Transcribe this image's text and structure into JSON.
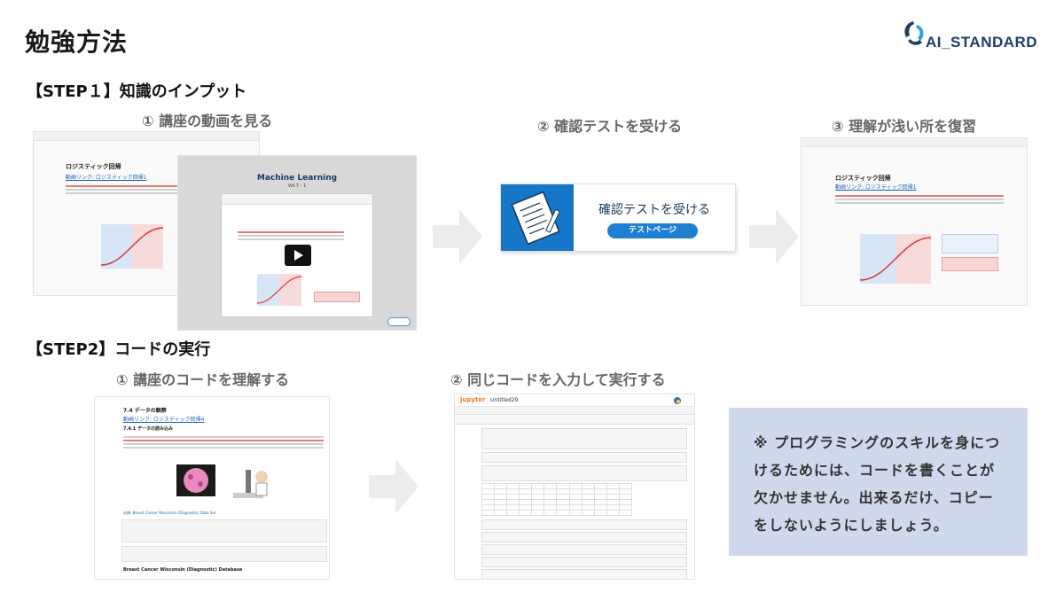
{
  "page": {
    "title": "勉強方法",
    "logo_text": "AI_STANDARD"
  },
  "step1": {
    "heading": "【STEP１】知識のインプット",
    "sub1": "① 講座の動画を見る",
    "sub2": "② 確認テストを受ける",
    "sub3": "③ 理解が浅い所を復習",
    "video": {
      "title": "Machine Learning",
      "vol": "Vol.7 - 1"
    },
    "lesson": {
      "title": "ロジスティック回帰",
      "link": "動画リンク: ロジスティック回帰1"
    },
    "test": {
      "title": "確認テストを受ける",
      "button": "テストページ"
    }
  },
  "step2": {
    "heading": "【STEP2】コードの実行",
    "sub1": "① 講座のコードを理解する",
    "sub2": "② 同じコードを入力して実行する",
    "code_doc": {
      "section": "7.4 データの観察",
      "link": "動画リンク: ロジスティック回帰4",
      "subsection": "7.4.1 データの読み込み",
      "caption": "出典: Breast Cancer Wisconsin (Diagnostic) Data Set",
      "db_title": "Breast Cancer Wisconsin (Diagnostic) Database"
    },
    "jupyter": {
      "logo": "jupyter",
      "notebook": "Untitled29"
    }
  },
  "note": {
    "line1": "※ プログラミングのスキルを身につ",
    "line2": "けるためには、コードを書くことが",
    "line3": "欠かせません。出来るだけ、コピー",
    "line4": "をしないようにしましょう。"
  },
  "colors": {
    "accent_blue": "#1677c9",
    "note_bg": "#d0d9ec",
    "arrow_gray": "#ececec"
  }
}
